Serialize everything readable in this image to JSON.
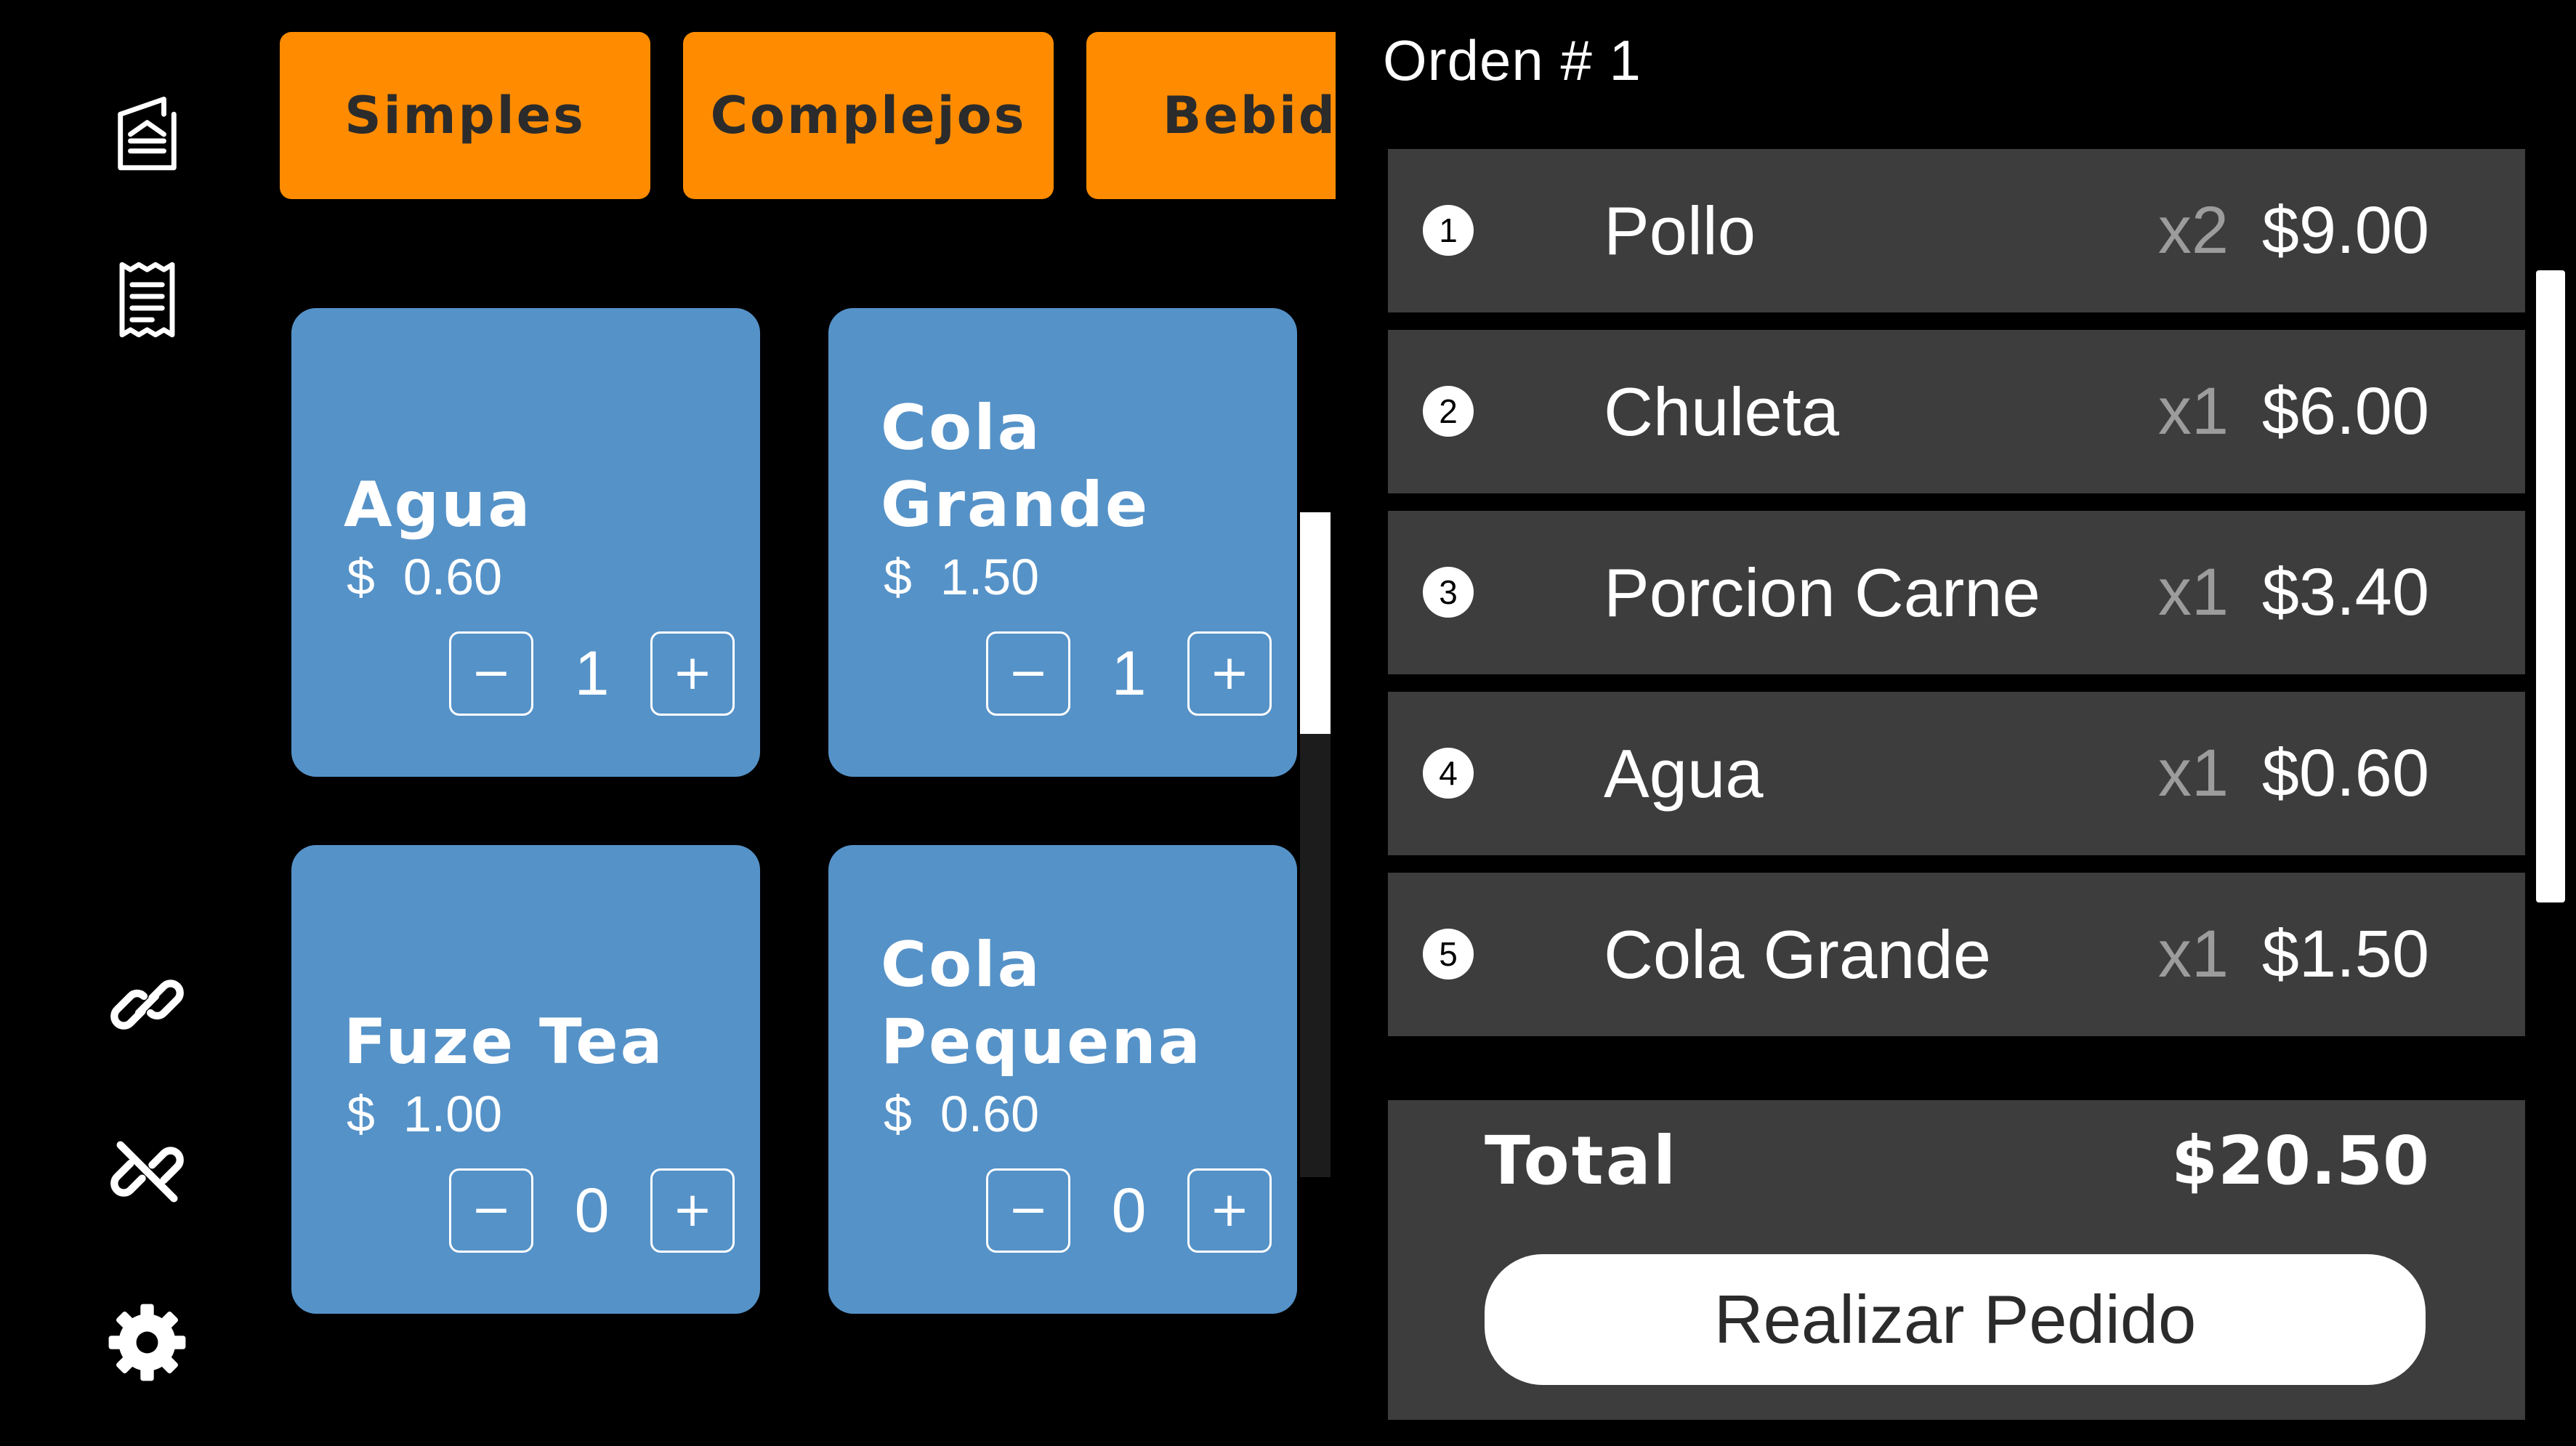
{
  "sidebar": {
    "icons": [
      "menu-book-icon",
      "receipt-icon",
      "link-icon",
      "unlink-icon",
      "gear-icon"
    ]
  },
  "categories": {
    "tabs": [
      {
        "label": "Simples"
      },
      {
        "label": "Complejos"
      },
      {
        "label": "Bebidas"
      }
    ]
  },
  "products": [
    {
      "name": "Agua",
      "currency": "$",
      "price": "0.60",
      "price_text": "$  0.60",
      "quantity": "1",
      "minus": "−",
      "plus": "+"
    },
    {
      "name": "Cola Grande",
      "currency": "$",
      "price": "1.50",
      "price_text": "$  1.50",
      "quantity": "1",
      "minus": "−",
      "plus": "+"
    },
    {
      "name": "Fuze Tea",
      "currency": "$",
      "price": "1.00",
      "price_text": "$  1.00",
      "quantity": "0",
      "minus": "−",
      "plus": "+"
    },
    {
      "name": "Cola Pequena",
      "currency": "$",
      "price": "0.60",
      "price_text": "$  0.60",
      "quantity": "0",
      "minus": "−",
      "plus": "+"
    }
  ],
  "order": {
    "title": "Orden # 1",
    "items": [
      {
        "number": "1",
        "name": "Pollo",
        "qty": "x2",
        "price": "$9.00"
      },
      {
        "number": "2",
        "name": "Chuleta",
        "qty": "x1",
        "price": "$6.00"
      },
      {
        "number": "3",
        "name": "Porcion Carne",
        "qty": "x1",
        "price": "$3.40"
      },
      {
        "number": "4",
        "name": "Agua",
        "qty": "x1",
        "price": "$0.60"
      },
      {
        "number": "5",
        "name": "Cola Grande",
        "qty": "x1",
        "price": "$1.50"
      }
    ],
    "total_label": "Total",
    "total_value": "$20.50",
    "submit_label": "Realizar Pedido"
  },
  "colors": {
    "background": "#000000",
    "tab_accent": "#FF8C00",
    "product_card": "#5592C8",
    "order_row": "#3D3D3D",
    "qty_muted": "#9C9C9C"
  }
}
